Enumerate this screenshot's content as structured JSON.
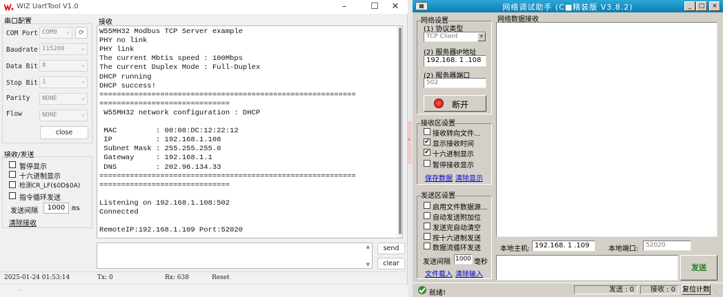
{
  "left_window": {
    "title": "WIZ UartTool V1.0",
    "serial_group": {
      "title": "串口配置",
      "com_port": {
        "label": "COM Port",
        "value": "COM9"
      },
      "baudrate": {
        "label": "Baudrate",
        "value": "115200"
      },
      "data_bit": {
        "label": "Data Bit",
        "value": "8"
      },
      "stop_bit": {
        "label": "Stop Bit",
        "value": "1"
      },
      "parity": {
        "label": "Parity",
        "value": "NONE"
      },
      "flow": {
        "label": "Flow",
        "value": "NONE"
      },
      "close_label": "close"
    },
    "rxtx_group": {
      "title": "接收/发送",
      "pause_display": "暂停显示",
      "hex_display": "十六进制显示",
      "detect_crlf": "检测CR_LF($0D$0A)",
      "cmd_loop": "指令循环发送",
      "send_interval_label": "发送间隔",
      "send_interval_value": "1000",
      "send_interval_unit": "ms",
      "clear_recv": "清除接收"
    },
    "receive": {
      "title": "接收",
      "lines": [
        "W55MH32 Modbus TCP Server example",
        "PHY no link",
        "PHY link",
        "The current Mbtis speed : 100Mbps",
        "The current Duplex Mode : Full-Duplex",
        "DHCP running",
        "DHCP success!",
        "===========================================================",
        "==============================",
        " W55MH32 network configuration : DHCP",
        "",
        " MAC         : 00:08:DC:12:22:12",
        " IP          : 192.168.1.108",
        " Subnet Mask : 255.255.255.0",
        " Gateway     : 192.168.1.1",
        " DNS         : 202.96.134.33",
        "===========================================================",
        "==============================",
        "",
        "Listening on 192.168.1.108:502",
        "Connected",
        "",
        "RemoteIP:192.168.1.109 Port:52020"
      ]
    },
    "send_label": "send",
    "clear_label": "clear",
    "status": {
      "datetime": "2025-01-24 01:53:14",
      "tx": "Tx: 0",
      "rx": "Rx: 638",
      "reset": "Reset"
    }
  },
  "right_window": {
    "title": "网络调试助手 (C■精装版 V3.8.2)",
    "net_settings": {
      "title": "网络设置",
      "protocol_label": "(1) 协议类型",
      "protocol_value": "TCP Client",
      "server_ip_label": "(2) 服务器IP地址",
      "server_ip_value": "192.168. 1 .108",
      "server_port_label": "(2) 服务器端口",
      "server_port_value": "502",
      "disconnect_label": "断开"
    },
    "recv_settings": {
      "title": "接收区设置",
      "opt1": "接收转向文件...",
      "opt2": "显示接收时间",
      "opt3": "十六进制显示",
      "opt4": "暂停接收显示",
      "save_data": "保存数据",
      "clear_display": "清除显示"
    },
    "send_settings": {
      "title": "发送区设置",
      "opt1": "启用文件数据源...",
      "opt2": "自动发送附加位",
      "opt3": "发送完自动清空",
      "opt4": "按十六进制发送",
      "opt5": "数据流循环发送",
      "interval_label": "发送间隔",
      "interval_value": "1000",
      "interval_unit": "毫秒",
      "file_load": "文件载入",
      "clear_input": "清除输入"
    },
    "recv_area_title": "网络数据接收",
    "local_host_label": "本地主机:",
    "local_host_value": "192.168. 1 .109",
    "local_port_label": "本地端口:",
    "local_port_value": "52020",
    "send_button": "发送",
    "status": {
      "ready": "就绪!",
      "send_count": "发送 : 0",
      "recv_count": "接收 : 0",
      "reset_count": "复位计数"
    }
  },
  "colors": {
    "accent_blue": "#0d7cb3",
    "send_green": "#1a7a1a",
    "disconnect_red": "#e01010",
    "link_blue": "#0000cc"
  }
}
